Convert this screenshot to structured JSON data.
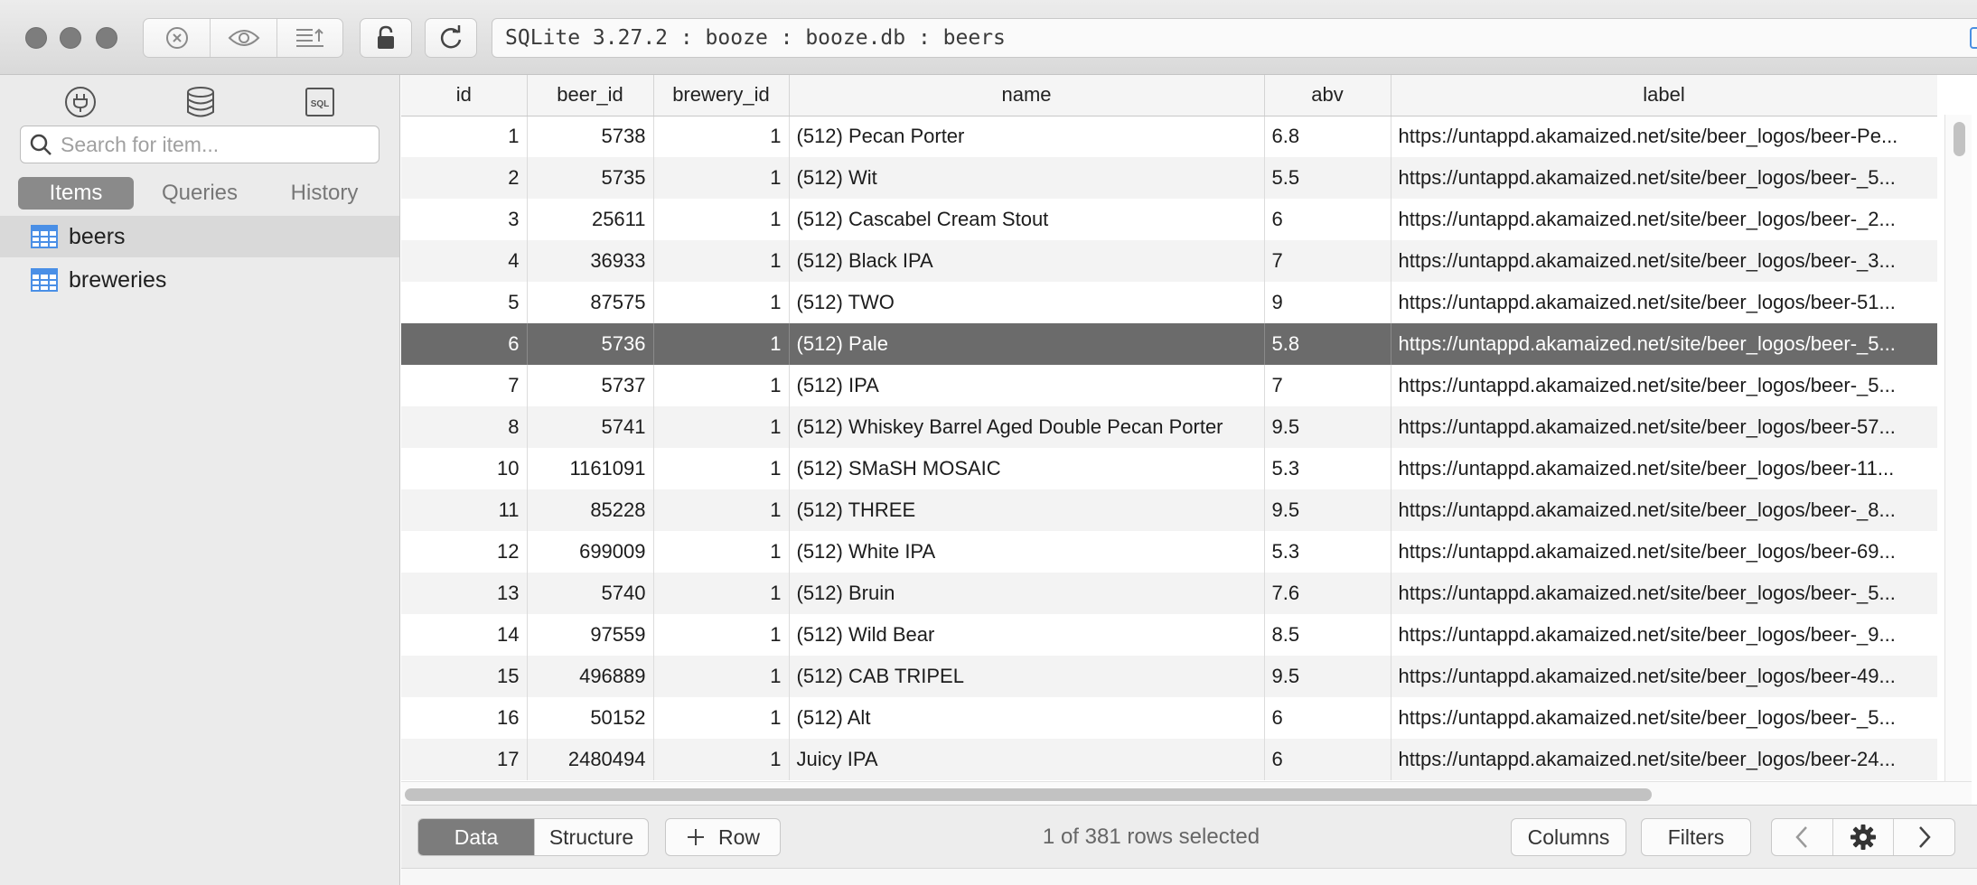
{
  "window": {
    "address_text": "SQLite 3.27.2 : booze : booze.db : beers"
  },
  "toolbar_icons": [
    "close-circle-icon",
    "eye-icon",
    "align-export-icon",
    "lock-icon",
    "refresh-icon"
  ],
  "sidebar": {
    "search_placeholder": "Search for item...",
    "tabs": [
      {
        "label": "Items",
        "active": true
      },
      {
        "label": "Queries",
        "active": false
      },
      {
        "label": "History",
        "active": false
      }
    ],
    "items": [
      {
        "label": "beers",
        "selected": true
      },
      {
        "label": "breweries",
        "selected": false
      }
    ]
  },
  "table": {
    "columns": [
      "id",
      "beer_id",
      "brewery_id",
      "name",
      "abv",
      "label"
    ],
    "rows": [
      [
        "1",
        "5738",
        "1",
        "(512) Pecan Porter",
        "6.8",
        "https://untappd.akamaized.net/site/beer_logos/beer-Pe..."
      ],
      [
        "2",
        "5735",
        "1",
        "(512) Wit",
        "5.5",
        "https://untappd.akamaized.net/site/beer_logos/beer-_5..."
      ],
      [
        "3",
        "25611",
        "1",
        "(512) Cascabel Cream Stout",
        "6",
        "https://untappd.akamaized.net/site/beer_logos/beer-_2..."
      ],
      [
        "4",
        "36933",
        "1",
        "(512) Black IPA",
        "7",
        "https://untappd.akamaized.net/site/beer_logos/beer-_3..."
      ],
      [
        "5",
        "87575",
        "1",
        "(512) TWO",
        "9",
        "https://untappd.akamaized.net/site/beer_logos/beer-51..."
      ],
      [
        "6",
        "5736",
        "1",
        "(512) Pale",
        "5.8",
        "https://untappd.akamaized.net/site/beer_logos/beer-_5..."
      ],
      [
        "7",
        "5737",
        "1",
        "(512) IPA",
        "7",
        "https://untappd.akamaized.net/site/beer_logos/beer-_5..."
      ],
      [
        "8",
        "5741",
        "1",
        "(512) Whiskey Barrel Aged Double Pecan Porter",
        "9.5",
        "https://untappd.akamaized.net/site/beer_logos/beer-57..."
      ],
      [
        "10",
        "1161091",
        "1",
        "(512) SMaSH MOSAIC",
        "5.3",
        "https://untappd.akamaized.net/site/beer_logos/beer-11..."
      ],
      [
        "11",
        "85228",
        "1",
        "(512) THREE",
        "9.5",
        "https://untappd.akamaized.net/site/beer_logos/beer-_8..."
      ],
      [
        "12",
        "699009",
        "1",
        "(512) White IPA",
        "5.3",
        "https://untappd.akamaized.net/site/beer_logos/beer-69..."
      ],
      [
        "13",
        "5740",
        "1",
        "(512) Bruin",
        "7.6",
        "https://untappd.akamaized.net/site/beer_logos/beer-_5..."
      ],
      [
        "14",
        "97559",
        "1",
        "(512) Wild Bear",
        "8.5",
        "https://untappd.akamaized.net/site/beer_logos/beer-_9..."
      ],
      [
        "15",
        "496889",
        "1",
        "(512) CAB TRIPEL",
        "9.5",
        "https://untappd.akamaized.net/site/beer_logos/beer-49..."
      ],
      [
        "16",
        "50152",
        "1",
        "(512) Alt",
        "6",
        "https://untappd.akamaized.net/site/beer_logos/beer-_5..."
      ],
      [
        "17",
        "2480494",
        "1",
        "Juicy IPA",
        "6",
        "https://untappd.akamaized.net/site/beer_logos/beer-24..."
      ]
    ],
    "selected_row_id": "6"
  },
  "bottom": {
    "view_tabs": [
      {
        "label": "Data",
        "active": true
      },
      {
        "label": "Structure",
        "active": false
      }
    ],
    "add_row_label": "Row",
    "status": "1 of 381 rows selected",
    "columns_label": "Columns",
    "filters_label": "Filters"
  },
  "colors": {
    "selected_row": "#6b6b6b",
    "table_icon": "#4a8fe6"
  }
}
